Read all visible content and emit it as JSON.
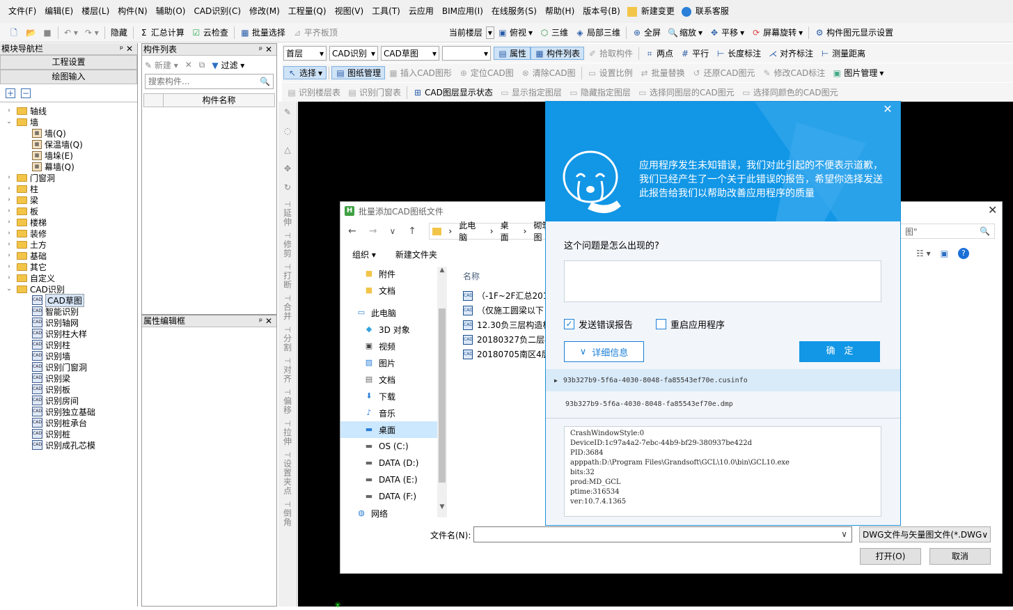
{
  "menu": [
    "文件(F)",
    "编辑(E)",
    "楼层(L)",
    "构件(N)",
    "辅助(O)",
    "CAD识别(C)",
    "修改(M)",
    "工程量(Q)",
    "视图(V)",
    "工具(T)",
    "云应用",
    "BIM应用(I)",
    "在线服务(S)",
    "帮助(H)",
    "版本号(B)",
    "新建变更",
    "联系客服"
  ],
  "toolbar": {
    "hide": "隐藏",
    "sum": "汇总计算",
    "cloud_check": "云检查",
    "batch_select": "批量选择",
    "flat_top": "平齐板顶",
    "floor_label": "当前楼层",
    "top_view": "俯视",
    "three_d": "三维",
    "local_3d": "局部三维",
    "fullscreen": "全屏",
    "zoom": "缩放",
    "pan": "平移",
    "rotate": "屏幕旋转",
    "display_settings": "构件图元显示设置"
  },
  "left": {
    "title": "模块导航栏",
    "btn_project": "工程设置",
    "btn_drawing": "绘图输入",
    "tree": [
      {
        "label": "轴线",
        "level": 0,
        "open": false
      },
      {
        "label": "墙",
        "level": 0,
        "open": true
      },
      {
        "label": "墙(Q)",
        "level": 1,
        "icon": "wall"
      },
      {
        "label": "保温墙(Q)",
        "level": 1,
        "icon": "wall"
      },
      {
        "label": "墙垛(E)",
        "level": 1,
        "icon": "wall"
      },
      {
        "label": "幕墙(Q)",
        "level": 1,
        "icon": "wall"
      },
      {
        "label": "门窗洞",
        "level": 0,
        "open": false
      },
      {
        "label": "柱",
        "level": 0,
        "open": false
      },
      {
        "label": "梁",
        "level": 0,
        "open": false
      },
      {
        "label": "板",
        "level": 0,
        "open": false
      },
      {
        "label": "楼梯",
        "level": 0,
        "open": false
      },
      {
        "label": "装修",
        "level": 0,
        "open": false
      },
      {
        "label": "土方",
        "level": 0,
        "open": false
      },
      {
        "label": "基础",
        "level": 0,
        "open": false
      },
      {
        "label": "其它",
        "level": 0,
        "open": false
      },
      {
        "label": "自定义",
        "level": 0,
        "open": false
      },
      {
        "label": "CAD识别",
        "level": 0,
        "open": true
      },
      {
        "label": "CAD草图",
        "level": 1,
        "icon": "cad",
        "selected": true
      },
      {
        "label": "智能识别",
        "level": 1,
        "icon": "cad"
      },
      {
        "label": "识别轴网",
        "level": 1,
        "icon": "cad"
      },
      {
        "label": "识别柱大样",
        "level": 1,
        "icon": "cad"
      },
      {
        "label": "识别柱",
        "level": 1,
        "icon": "cad"
      },
      {
        "label": "识别墙",
        "level": 1,
        "icon": "cad"
      },
      {
        "label": "识别门窗洞",
        "level": 1,
        "icon": "cad"
      },
      {
        "label": "识别梁",
        "level": 1,
        "icon": "cad"
      },
      {
        "label": "识别板",
        "level": 1,
        "icon": "cad"
      },
      {
        "label": "识别房间",
        "level": 1,
        "icon": "cad"
      },
      {
        "label": "识别独立基础",
        "level": 1,
        "icon": "cad"
      },
      {
        "label": "识别桩承台",
        "level": 1,
        "icon": "cad"
      },
      {
        "label": "识别桩",
        "level": 1,
        "icon": "cad"
      },
      {
        "label": "识别成孔芯模",
        "level": 1,
        "icon": "cad"
      }
    ]
  },
  "complist": {
    "title": "构件列表",
    "new": "新建",
    "filter": "过滤",
    "search_placeholder": "搜索构件...",
    "col": "构件名称"
  },
  "propbox": {
    "title": "属性编辑框"
  },
  "ribbon1": {
    "floor": "首层",
    "type": "CAD识别",
    "sub": "CAD草图",
    "attr": "属性",
    "list": "构件列表",
    "pick": "拾取构件",
    "two_points": "两点",
    "parallel": "平行",
    "length_mark": "长度标注",
    "align_mark": "对齐标注",
    "measure": "测量距离"
  },
  "ribbon2": {
    "select": "选择",
    "drawing_mgr": "图纸管理",
    "insert": "插入CAD图形",
    "locate": "定位CAD图",
    "clear": "清除CAD图",
    "scale": "设置比例",
    "batch_replace": "批量替换",
    "restore": "还原CAD图元",
    "modify_mark": "修改CAD标注",
    "img_mgr": "图片管理"
  },
  "ribbon3": {
    "floor_table": "识别楼层表",
    "door_table": "识别门窗表",
    "layer_state": "CAD图层显示状态",
    "show_layer": "显示指定图层",
    "hide_layer": "隐藏指定图层",
    "same_layer": "选择同图层的CAD图元",
    "same_color": "选择同颜色的CAD图元"
  },
  "vtool": [
    "延伸",
    "修剪",
    "打断",
    "合并",
    "分割",
    "对齐",
    "偏移",
    "拉伸",
    "设置夹点",
    "倒角"
  ],
  "file_dialog": {
    "title": "批量添加CAD图纸文件",
    "crumbs": [
      "此电脑",
      "桌面",
      "砌筑图"
    ],
    "search_tail": "图\"",
    "organize": "组织",
    "new_folder": "新建文件夹",
    "col_name": "名称",
    "nav": [
      {
        "label": "附件",
        "icon": "folder"
      },
      {
        "label": "文档",
        "icon": "folder"
      },
      {
        "label": "此电脑",
        "icon": "pc"
      },
      {
        "label": "3D 对象",
        "icon": "cube"
      },
      {
        "label": "视频",
        "icon": "video"
      },
      {
        "label": "图片",
        "icon": "picture"
      },
      {
        "label": "文档",
        "icon": "doc"
      },
      {
        "label": "下载",
        "icon": "download"
      },
      {
        "label": "音乐",
        "icon": "music"
      },
      {
        "label": "桌面",
        "icon": "desktop",
        "selected": true
      },
      {
        "label": "OS (C:)",
        "icon": "drive"
      },
      {
        "label": "DATA (D:)",
        "icon": "drive"
      },
      {
        "label": "DATA (E:)",
        "icon": "drive"
      },
      {
        "label": "DATA (F:)",
        "icon": "drive"
      },
      {
        "label": "网络",
        "icon": "network"
      }
    ],
    "files": [
      "（-1F~2F汇总201",
      "（仅施工圆梁以下",
      "12.30负三层构造柱",
      "20180327负二层柱",
      "20180705南区4层"
    ],
    "filename_label": "文件名(N):",
    "filetype": "DWG文件与矢量图文件(*.DWG",
    "open": "打开(O)",
    "cancel": "取消"
  },
  "error_dialog": {
    "message": "应用程序发生未知错误，我们对此引起的不便表示道歉，我们已经产生了一个关于此错误的报告，希望你选择发送此报告给我们以帮助改善应用程序的质量",
    "question": "这个问题是怎么出现的?",
    "send_report": "发送错误报告",
    "restart": "重启应用程序",
    "details": "详细信息",
    "ok": "确　定",
    "file1": "93b327b9-5f6a-4030-8048-fa85543ef70e.cusinfo",
    "file2": "93b327b9-5f6a-4030-8048-fa85543ef70e.dmp",
    "log": [
      "CrashWindowStyle:0",
      "DeviceID:1c97a4a2-7ebc-44b9-bf29-380937be422d",
      "PID:3684",
      "apppath:D:\\Program Files\\Grandsoft\\GCL\\10.0\\bin\\GCL10.exe",
      "bits:32",
      "prod:MD_GCL",
      "ptime:316534",
      "ver:10.7.4.1365"
    ],
    "send_checked": true,
    "restart_checked": false,
    "accent": "#1296e6"
  }
}
